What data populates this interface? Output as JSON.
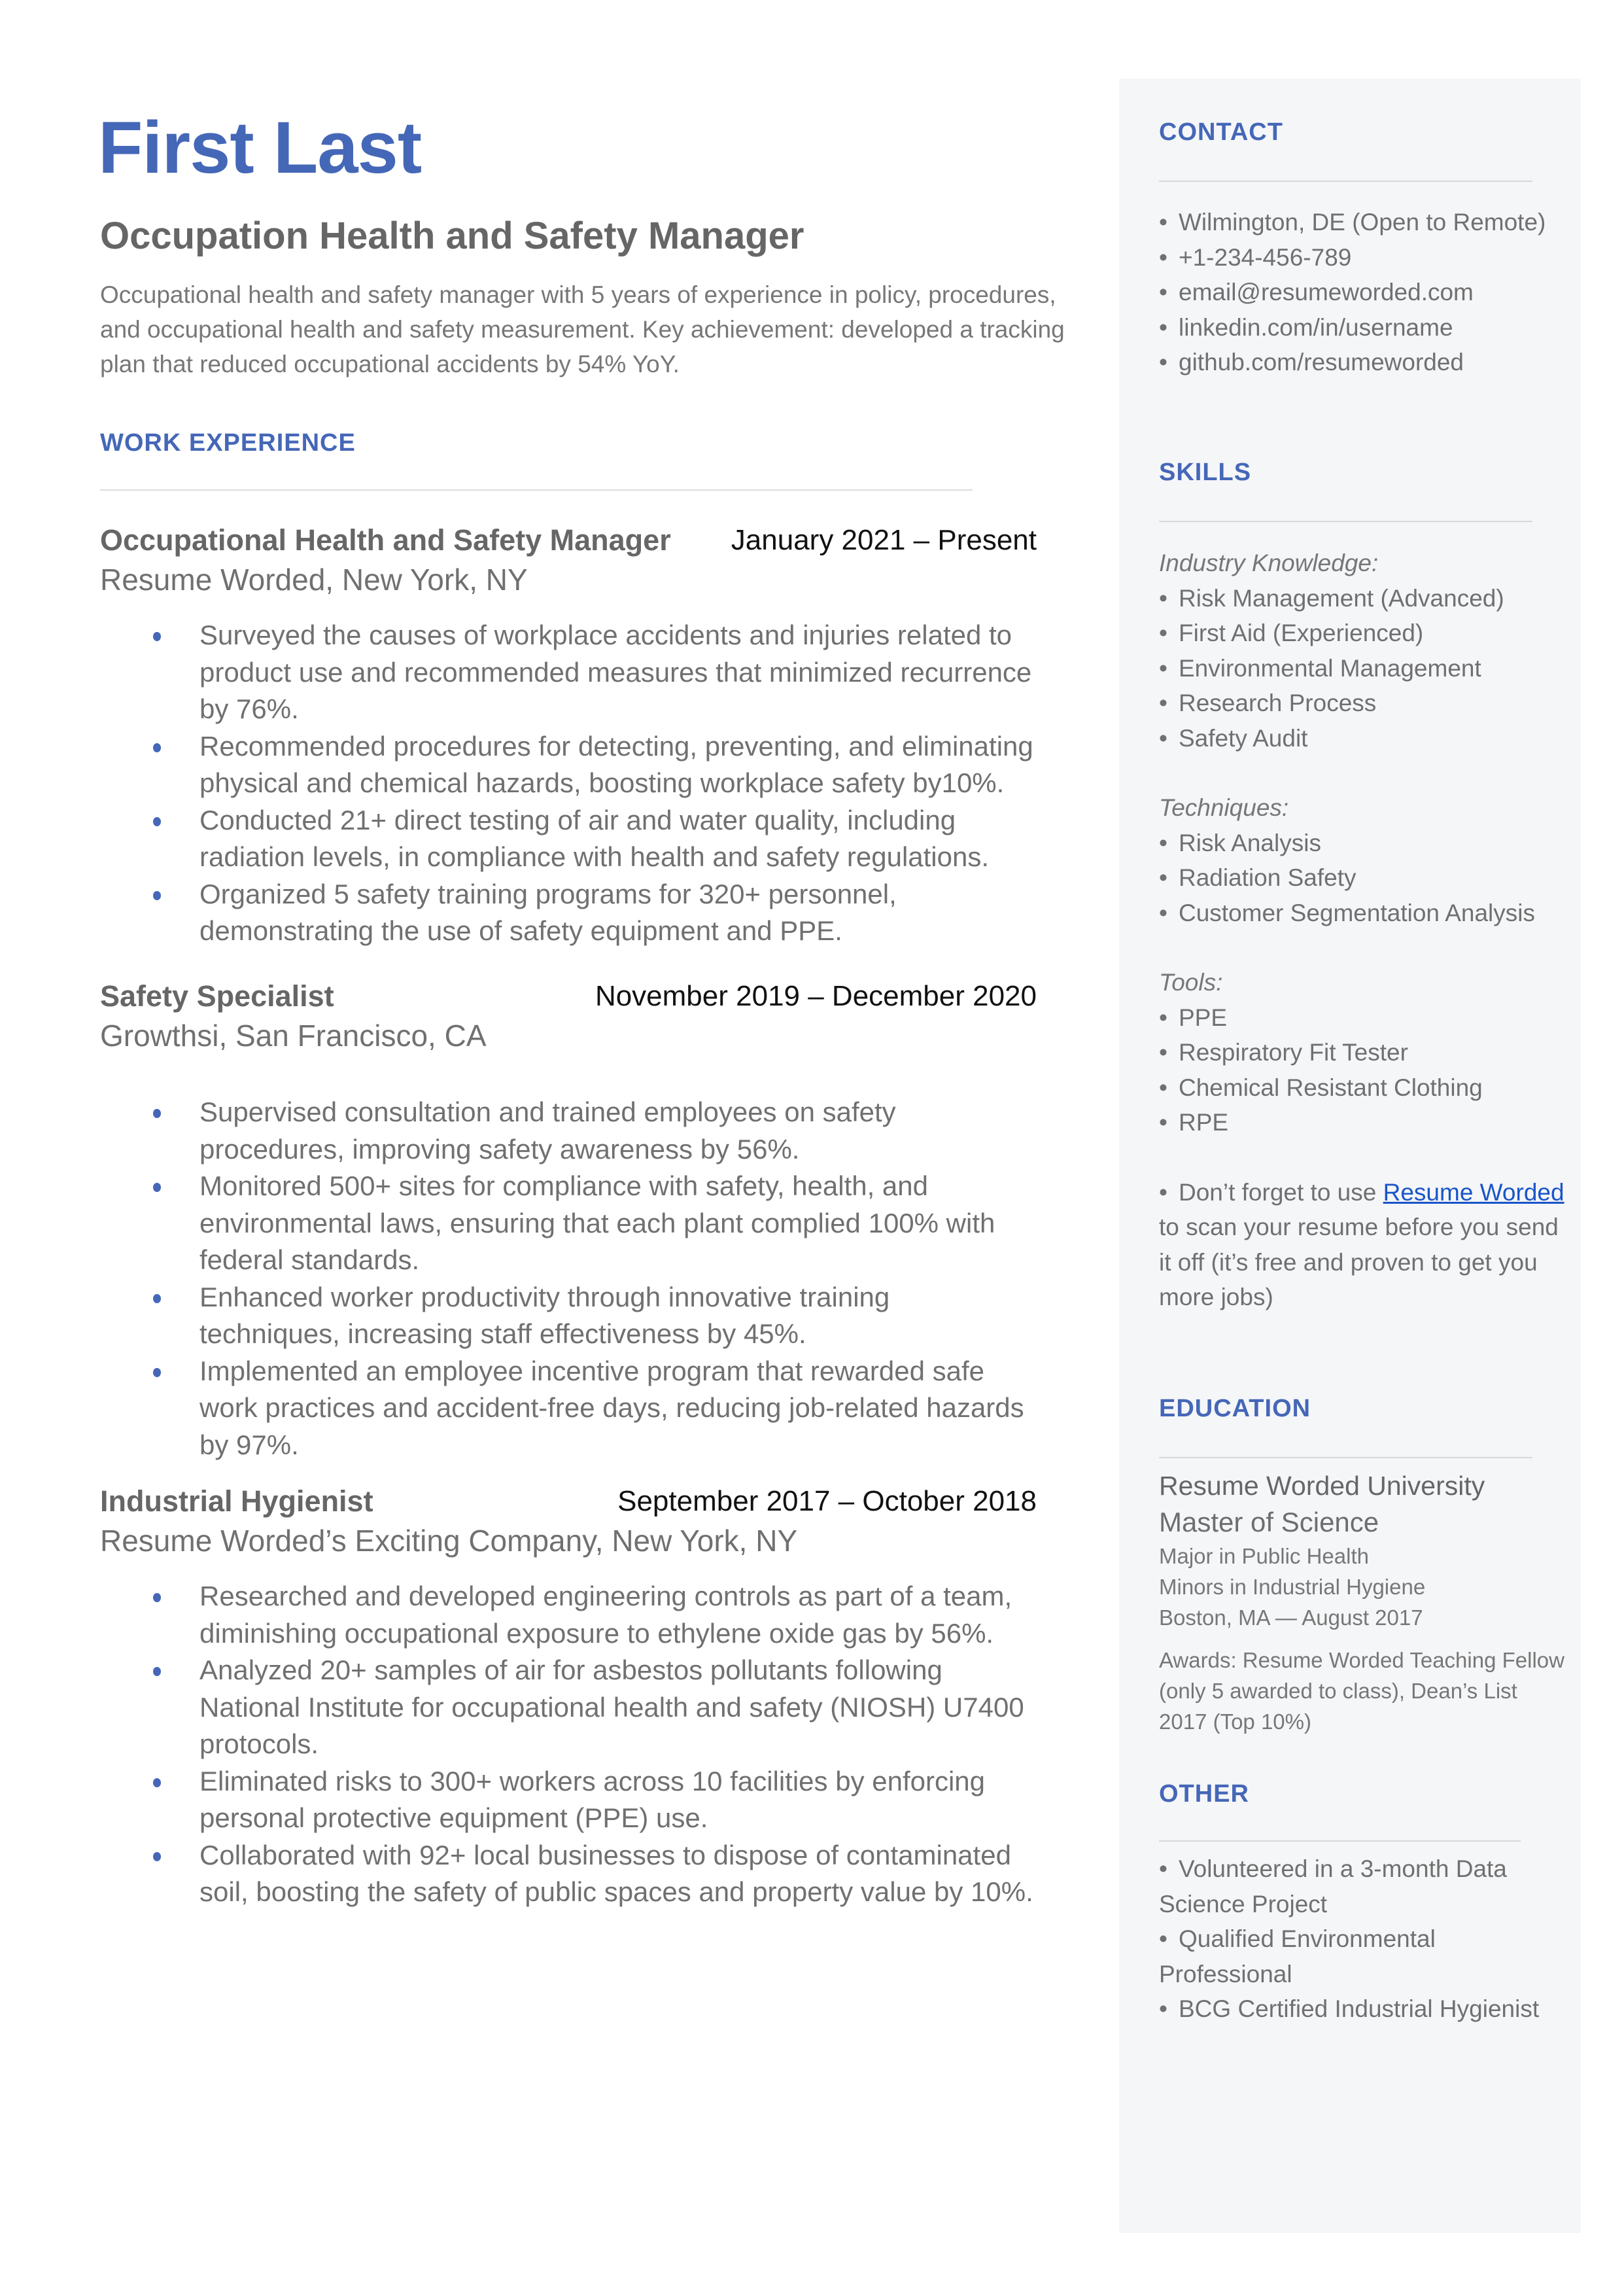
{
  "header": {
    "name": "First Last",
    "headline": "Occupation Health and Safety Manager",
    "summary": "Occupational health and safety manager with 5 years of experience in policy, procedures, and occupational health and safety measurement. Key achievement: developed a tracking plan that reduced occupational accidents by 54% YoY."
  },
  "colors": {
    "accent": "#4567b7",
    "sidebar_bg": "#f5f6f8",
    "link": "#1a55c9"
  },
  "work": {
    "title": "WORK EXPERIENCE",
    "jobs": [
      {
        "title": "Occupational Health and Safety Manager",
        "dates": "January 2021 – Present",
        "company": "Resume Worded, New York, NY",
        "bullets": [
          "Surveyed the causes of workplace accidents and injuries related to product use and recommended measures that minimized recurrence by 76%.",
          "Recommended procedures for detecting, preventing, and eliminating physical and chemical hazards, boosting workplace safety by10%.",
          "Conducted 21+ direct testing of air and water quality, including radiation levels, in compliance with health and safety regulations.",
          "Organized 5 safety training programs for 320+ personnel, demonstrating the use of safety equipment and PPE."
        ]
      },
      {
        "title": "Safety Specialist",
        "dates": "November 2019 – December 2020",
        "company": "Growthsi, San Francisco, CA",
        "bullets": [
          "Supervised consultation and trained employees on safety procedures, improving safety awareness by 56%.",
          "Monitored 500+ sites for compliance with safety, health, and environmental laws, ensuring that each plant complied 100% with federal standards.",
          "Enhanced worker productivity through innovative training techniques, increasing staff effectiveness by 45%.",
          "Implemented an employee incentive program that rewarded safe work practices and accident-free days, reducing job-related hazards by 97%."
        ]
      },
      {
        "title": "Industrial Hygienist",
        "dates": "September 2017 – October 2018",
        "company": "Resume Worded’s Exciting Company, New York, NY",
        "bullets": [
          "Researched and developed engineering controls as part of a team, diminishing occupational exposure to ethylene oxide gas by 56%.",
          "Analyzed 20+ samples of air for asbestos pollutants following National Institute for occupational health and safety (NIOSH) U7400 protocols.",
          "Eliminated risks to 300+ workers across 10 facilities by enforcing personal protective equipment (PPE) use.",
          "Collaborated with 92+ local businesses to dispose of contaminated soil, boosting the safety of public spaces and property value by 10%."
        ]
      }
    ]
  },
  "contact": {
    "title": "CONTACT",
    "items": [
      "Wilmington, DE (Open to Remote)",
      "+1-234-456-789",
      "email@resumeworded.com",
      "linkedin.com/in/username",
      "github.com/resumeworded"
    ]
  },
  "skills": {
    "title": "SKILLS",
    "groups": [
      {
        "label": "Industry Knowledge:",
        "items": [
          "Risk Management (Advanced)",
          "First Aid (Experienced)",
          "Environmental Management",
          "Research Process",
          "Safety Audit"
        ]
      },
      {
        "label": "Techniques:",
        "items": [
          "Risk Analysis",
          "Radiation Safety",
          "Customer Segmentation Analysis"
        ]
      },
      {
        "label": "Tools:",
        "items": [
          "PPE",
          "Respiratory Fit Tester",
          "Chemical Resistant Clothing",
          "RPE"
        ]
      }
    ],
    "promo": {
      "before": "Don’t forget to use ",
      "link": "Resume Worded",
      "after": " to scan your resume before you send it off (it’s free and proven to get you more jobs)"
    }
  },
  "education": {
    "title": "EDUCATION",
    "school": "Resume Worded University",
    "degree": "Master of Science",
    "major": "Major in Public Health",
    "minors": "Minors in Industrial Hygiene",
    "location_date": "Boston, MA — August 2017",
    "awards": "Awards: Resume Worded Teaching Fellow (only 5 awarded to class), Dean’s List 2017 (Top 10%)"
  },
  "other": {
    "title": "OTHER",
    "items": [
      "Volunteered in a 3-month Data Science Project",
      "Qualified Environmental Professional",
      "BCG Certified Industrial Hygienist"
    ]
  }
}
